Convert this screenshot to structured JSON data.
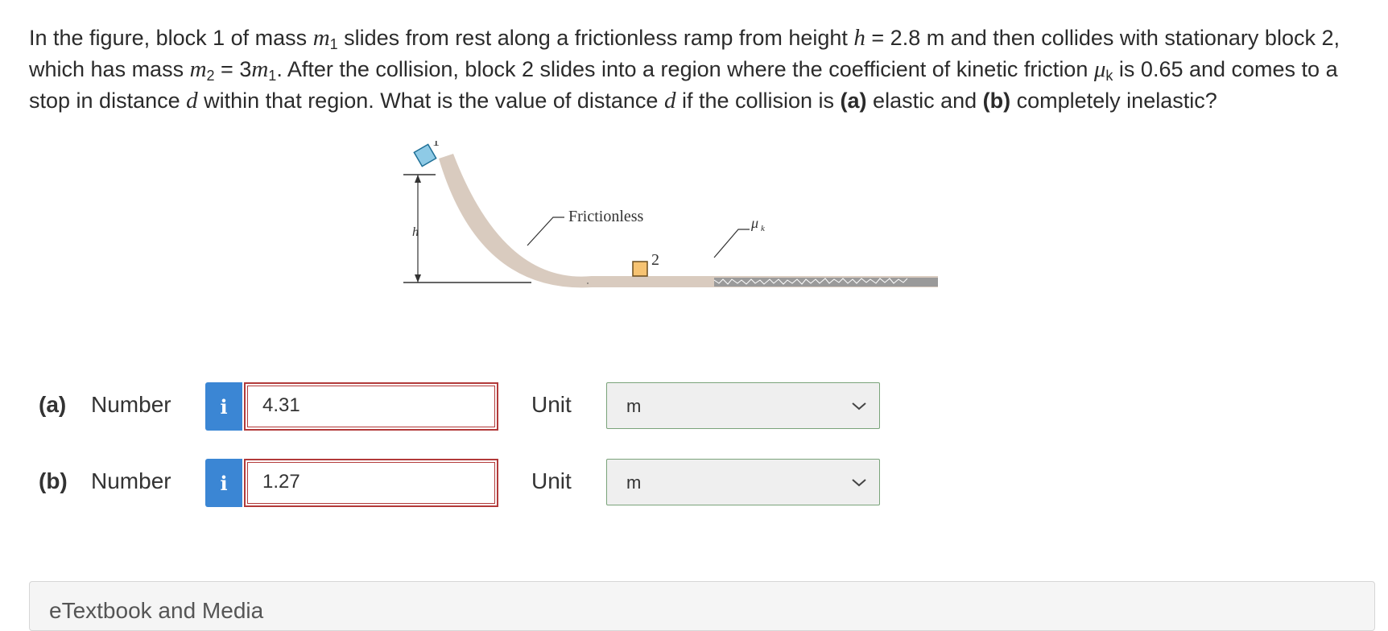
{
  "question": {
    "p1": "In the figure, block 1 of mass ",
    "m": "m",
    "sub1": "1",
    "p2": " slides from rest along a frictionless ramp from height ",
    "h": "h",
    "p3": " = 2.8 m and then collides with stationary block 2, which has mass ",
    "m2": "m",
    "sub2": "2",
    "p4": " = 3",
    "m3": "m",
    "sub3": "1",
    "p5": ". After the collision, block 2 slides into a region where the coefficient of kinetic friction ",
    "mu": "μ",
    "subk": "k",
    "p6": " is 0.65 and comes to a stop in distance ",
    "d1": "d",
    "p7": " within that region. What is the value of distance ",
    "d2": "d",
    "p8": " if the collision is ",
    "a": "(a)",
    "p9": " elastic and ",
    "b": "(b)",
    "p10": " completely inelastic?"
  },
  "figure": {
    "block1_label": "1",
    "block2_label": "2",
    "h_label": "h",
    "frictionless_label": "Frictionless",
    "mu_label": "μ",
    "mu_sub": "k",
    "block1_color": "#8ecae6",
    "block2_color": "#f6c372",
    "ramp_color": "#d9cbbf"
  },
  "answers": [
    {
      "part": "(a)",
      "number_label": "Number",
      "info": "i",
      "value": "4.31",
      "unit_label": "Unit",
      "unit": "m"
    },
    {
      "part": "(b)",
      "number_label": "Number",
      "info": "i",
      "value": "1.27",
      "unit_label": "Unit",
      "unit": "m"
    }
  ],
  "ebook": {
    "title": "eTextbook and Media"
  },
  "colors": {
    "info_button": "#3b86d4",
    "input_border": "#b23a3a",
    "select_border": "#7aa37a"
  }
}
